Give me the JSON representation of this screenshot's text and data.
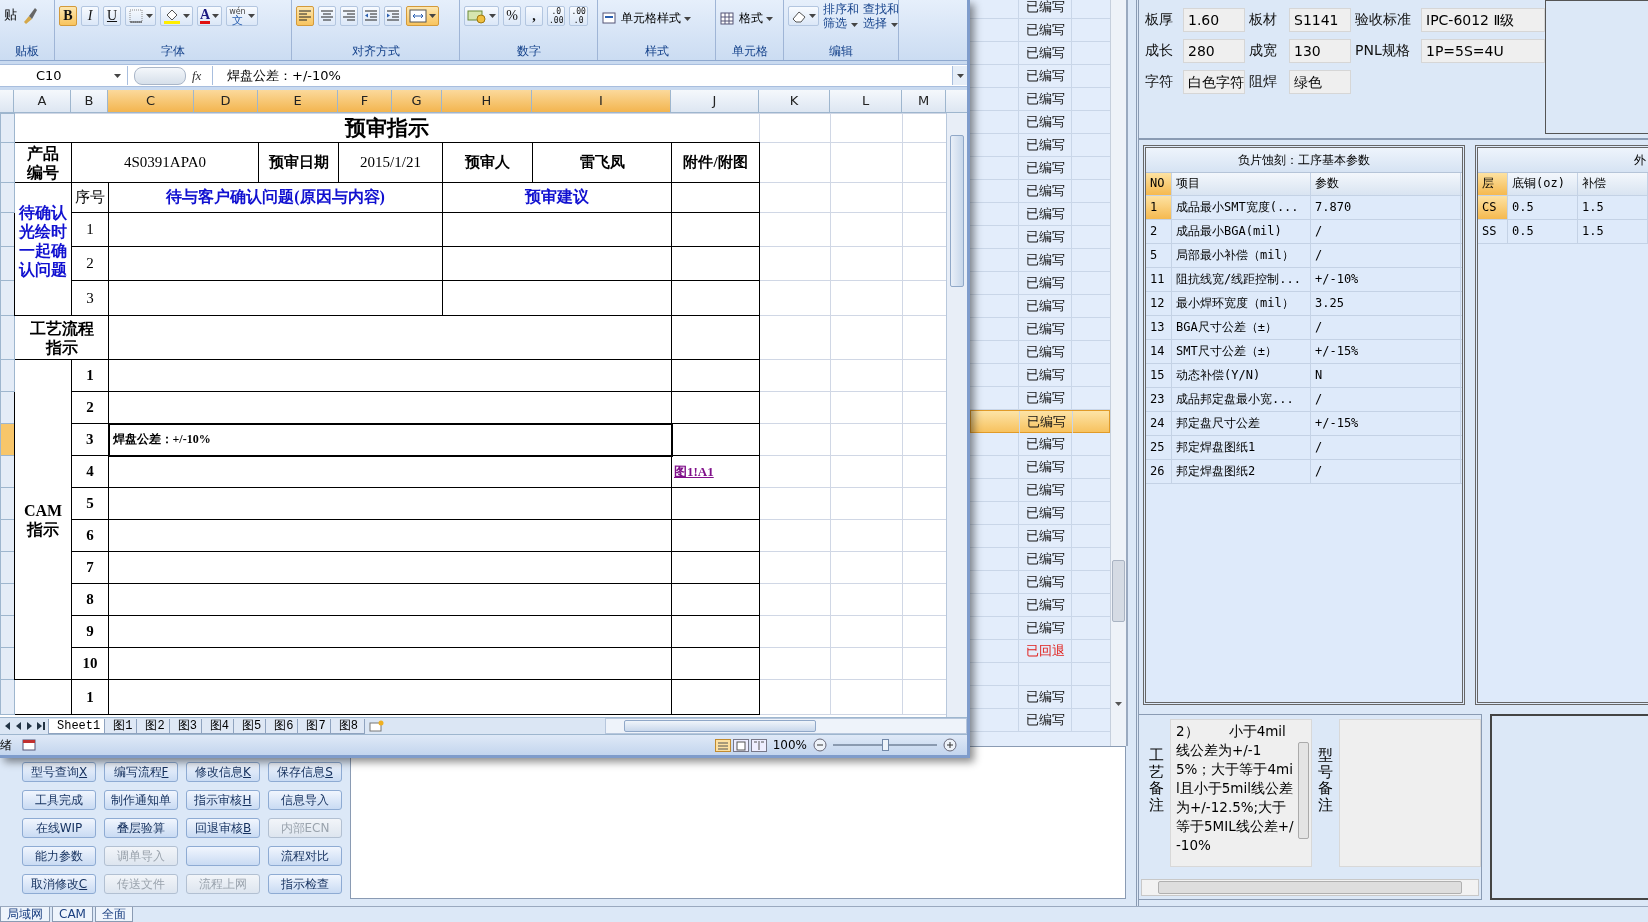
{
  "excel": {
    "ribbon": {
      "groups": [
        {
          "label": "贴板",
          "items": [
            {
              "kind": "cut_text",
              "text": "贴"
            },
            {
              "kind": "brush"
            }
          ]
        },
        {
          "label": "字体",
          "items": [
            {
              "kind": "bold",
              "text": "B",
              "selected": true
            },
            {
              "kind": "italic",
              "text": "I",
              "selected": false
            },
            {
              "kind": "underline",
              "text": "U",
              "selected": false
            },
            {
              "kind": "border"
            },
            {
              "kind": "fill"
            },
            {
              "kind": "font_color",
              "text": "A"
            },
            {
              "kind": "phonetic",
              "text": "wén",
              "sub": "文"
            }
          ]
        },
        {
          "label": "对齐方式",
          "items": [
            {
              "kind": "align_left",
              "selected": true
            },
            {
              "kind": "align_center",
              "selected": false
            },
            {
              "kind": "align_right",
              "selected": false
            },
            {
              "kind": "outdent"
            },
            {
              "kind": "indent"
            },
            {
              "kind": "merge",
              "selected": true
            }
          ]
        },
        {
          "label": "数字",
          "items": [
            {
              "kind": "number_format"
            },
            {
              "kind": "percent",
              "text": "%"
            },
            {
              "kind": "comma",
              "text": ","
            },
            {
              "kind": "inc_decimal",
              "text": ".0",
              "sub": ".00"
            },
            {
              "kind": "dec_decimal",
              "text": ".00",
              "sub": ".0"
            }
          ]
        },
        {
          "label": "样式",
          "items": [
            {
              "kind": "styles_dropdown",
              "text": "单元格样式"
            }
          ]
        },
        {
          "label": "单元格",
          "items": [
            {
              "kind": "format_dropdown",
              "text": "格式"
            }
          ]
        },
        {
          "label": "编辑",
          "items": [
            {
              "kind": "eraser"
            },
            {
              "kind": "sort_filter",
              "text": "排序和",
              "sub": "筛选"
            },
            {
              "kind": "find_select",
              "text": "查找和",
              "sub": "选择"
            }
          ]
        }
      ]
    },
    "name_box": "C10",
    "fx": "fx",
    "formula": "焊盘公差：+/-10%",
    "columns": [
      {
        "label": "A",
        "selected": false
      },
      {
        "label": "B",
        "selected": false
      },
      {
        "label": "C",
        "selected": true
      },
      {
        "label": "D",
        "selected": true
      },
      {
        "label": "E",
        "selected": true
      },
      {
        "label": "F",
        "selected": true
      },
      {
        "label": "G",
        "selected": true
      },
      {
        "label": "H",
        "selected": true
      },
      {
        "label": "I",
        "selected": true
      },
      {
        "label": "J",
        "selected": false
      },
      {
        "label": "K",
        "selected": false
      },
      {
        "label": "L",
        "selected": false
      },
      {
        "label": "M",
        "selected": false
      }
    ],
    "sheet": {
      "title": "预审指示",
      "info": {
        "product_label": "产品编号",
        "product_no": "4S0391APA0",
        "date_label": "预审日期",
        "date": "2015/1/21",
        "reviewer_label": "预审人",
        "reviewer": "雷飞凤",
        "attachment_label": "附件/附图"
      },
      "confirm": {
        "label": "待确认光绘时一起确认问题",
        "seq_header": "序号",
        "question_header": "待与客户确认问题(原因与内容)",
        "advice_header": "预审建议",
        "rows": [
          "1",
          "2",
          "3"
        ]
      },
      "process_label": "工艺流程指示",
      "cam": {
        "label": "CAM指示",
        "rows": [
          {
            "seq": "1",
            "selected": false
          },
          {
            "seq": "2",
            "selected": false
          },
          {
            "seq": "3",
            "content": "焊盘公差：+/-10%",
            "selected": true
          },
          {
            "seq": "4",
            "attachment": "图1!A1",
            "selected": false
          },
          {
            "seq": "5",
            "selected": false
          },
          {
            "seq": "6",
            "selected": false
          },
          {
            "seq": "7",
            "selected": false
          },
          {
            "seq": "8",
            "selected": false
          },
          {
            "seq": "9",
            "selected": false
          },
          {
            "seq": "10",
            "selected": false
          }
        ]
      },
      "next_rows": [
        "1"
      ]
    },
    "sheet_tabs": [
      {
        "label": "Sheet1",
        "selected": true
      },
      {
        "label": "图1",
        "selected": false
      },
      {
        "label": "图2",
        "selected": false
      },
      {
        "label": "图3",
        "selected": false
      },
      {
        "label": "图4",
        "selected": false
      },
      {
        "label": "图5",
        "selected": false
      },
      {
        "label": "图6",
        "selected": false
      },
      {
        "label": "图7",
        "selected": false
      },
      {
        "label": "图8",
        "selected": false
      }
    ],
    "status_bar": {
      "ready": "绪",
      "zoom": "100%",
      "zoom_slider": {
        "level": 0.5
      }
    }
  },
  "status_list": [
    {
      "text": "已编写",
      "kind": "done",
      "selected": false
    },
    {
      "text": "已编写",
      "kind": "done",
      "selected": false
    },
    {
      "text": "已编写",
      "kind": "done",
      "selected": false
    },
    {
      "text": "已编写",
      "kind": "done",
      "selected": false
    },
    {
      "text": "已编写",
      "kind": "done",
      "selected": false
    },
    {
      "text": "已编写",
      "kind": "done",
      "selected": false
    },
    {
      "text": "已编写",
      "kind": "done",
      "selected": false
    },
    {
      "text": "已编写",
      "kind": "done",
      "selected": false
    },
    {
      "text": "已编写",
      "kind": "done",
      "selected": false
    },
    {
      "text": "已编写",
      "kind": "done",
      "selected": false
    },
    {
      "text": "已编写",
      "kind": "done",
      "selected": false
    },
    {
      "text": "已编写",
      "kind": "done",
      "selected": false
    },
    {
      "text": "已编写",
      "kind": "done",
      "selected": false
    },
    {
      "text": "已编写",
      "kind": "done",
      "selected": false
    },
    {
      "text": "已编写",
      "kind": "done",
      "selected": false
    },
    {
      "text": "已编写",
      "kind": "done",
      "selected": false
    },
    {
      "text": "已编写",
      "kind": "done",
      "selected": false
    },
    {
      "text": "已编写",
      "kind": "done",
      "selected": false
    },
    {
      "text": "已编写",
      "kind": "done",
      "selected": true
    },
    {
      "text": "已编写",
      "kind": "done",
      "selected": false
    },
    {
      "text": "已编写",
      "kind": "done",
      "selected": false
    },
    {
      "text": "已编写",
      "kind": "done",
      "selected": false
    },
    {
      "text": "已编写",
      "kind": "done",
      "selected": false
    },
    {
      "text": "已编写",
      "kind": "done",
      "selected": false
    },
    {
      "text": "已编写",
      "kind": "done",
      "selected": false
    },
    {
      "text": "已编写",
      "kind": "done",
      "selected": false
    },
    {
      "text": "已编写",
      "kind": "done",
      "selected": false
    },
    {
      "text": "已编写",
      "kind": "done",
      "selected": false
    },
    {
      "text": "已回退",
      "kind": "returned",
      "selected": false
    },
    {
      "kind": "blank",
      "selected": false
    },
    {
      "text": "已编写",
      "kind": "done",
      "selected": false
    },
    {
      "text": "已编写",
      "kind": "done",
      "selected": false
    }
  ],
  "buttons": [
    {
      "label": "型号查询",
      "key": "X",
      "disabled": false
    },
    {
      "label": "编写流程",
      "key": "F",
      "disabled": false
    },
    {
      "label": "修改信息",
      "key": "K",
      "disabled": false
    },
    {
      "label": "保存信息",
      "key": "S",
      "disabled": false
    },
    {
      "label": "工具完成",
      "disabled": false
    },
    {
      "label": "制作通知单",
      "disabled": false
    },
    {
      "label": "指示审核",
      "key": "H",
      "disabled": false
    },
    {
      "label": "信息导入",
      "disabled": false
    },
    {
      "label": "在线WIP",
      "disabled": false
    },
    {
      "label": "叠层验算",
      "disabled": false
    },
    {
      "label": "回退审核",
      "key": "B",
      "disabled": false
    },
    {
      "label": "内部ECN",
      "disabled": true
    },
    {
      "label": "能力参数",
      "disabled": false
    },
    {
      "label": "调单导入",
      "disabled": true
    },
    {
      "disabled": false
    },
    {
      "label": "流程对比",
      "disabled": false
    },
    {
      "label": "取消修改",
      "key": "C",
      "disabled": false
    },
    {
      "label": "传送文件",
      "disabled": true
    },
    {
      "label": "流程上网",
      "disabled": true
    },
    {
      "label": "指示检查",
      "disabled": false
    }
  ],
  "field_rows": [
    {
      "fields": [
        {
          "label": "板厚",
          "value": "1.60"
        },
        {
          "label": "板材",
          "value": "S1141"
        },
        {
          "label": "验收标准",
          "value": "IPC-6012 Ⅱ级"
        }
      ]
    },
    {
      "fields": [
        {
          "label": "成长",
          "value": "280"
        },
        {
          "label": "成宽",
          "value": "130"
        },
        {
          "label": "PNL规格",
          "value": "1P=5S=4U"
        }
      ]
    },
    {
      "fields": [
        {
          "label": "字符",
          "value": "白色字符"
        },
        {
          "label": "阻焊",
          "value": "绿色"
        }
      ]
    }
  ],
  "process_grid": {
    "title": "负片蚀刻：工序基本参数",
    "columns": [
      "NO",
      "项目",
      "参数"
    ],
    "rows": [
      {
        "cells": [
          "1",
          "成品最小SMT宽度(...",
          "7.870"
        ],
        "selected": true
      },
      {
        "cells": [
          "2",
          "成品最小BGA(mil)",
          "/"
        ],
        "selected": false
      },
      {
        "cells": [
          "5",
          "局部最小补偿（mil）",
          "/"
        ],
        "selected": false
      },
      {
        "cells": [
          "11",
          "阻抗线宽/线距控制...",
          "+/-10%"
        ],
        "selected": false
      },
      {
        "cells": [
          "12",
          "最小焊环宽度（mil）",
          "3.25"
        ],
        "selected": false
      },
      {
        "cells": [
          "13",
          "BGA尺寸公差（±）",
          "/"
        ],
        "selected": false
      },
      {
        "cells": [
          "14",
          "SMT尺寸公差（±）",
          "+/-15%"
        ],
        "selected": false
      },
      {
        "cells": [
          "15",
          "动态补偿(Y/N)",
          "N"
        ],
        "selected": false
      },
      {
        "cells": [
          "23",
          "成品邦定盘最小宽...",
          "/"
        ],
        "selected": false
      },
      {
        "cells": [
          "24",
          "邦定盘尺寸公差",
          "+/-15%"
        ],
        "selected": false
      },
      {
        "cells": [
          "25",
          "邦定焊盘图纸1",
          "/"
        ],
        "selected": false
      },
      {
        "cells": [
          "26",
          "邦定焊盘图纸2",
          "/"
        ],
        "selected": false
      }
    ]
  },
  "copper_grid": {
    "title": "外",
    "columns": [
      "层",
      "底铜(oz)",
      "补偿"
    ],
    "rows": [
      {
        "cells": [
          "CS",
          "0.5",
          "1.5"
        ],
        "selected": true
      },
      {
        "cells": [
          "SS",
          "0.5",
          "1.5"
        ],
        "selected": false
      }
    ]
  },
  "process_note": {
    "label": "工艺备注",
    "text": "2）       小于4mil线公差为+/-15%；大于等于4mil且小于5mil线公差为+/-12.5%;大于等于5MIL线公差+/-10%"
  },
  "model_note": {
    "label": "型号备注"
  },
  "bottom_tabs": [
    "局域网",
    "CAM",
    "全面"
  ]
}
